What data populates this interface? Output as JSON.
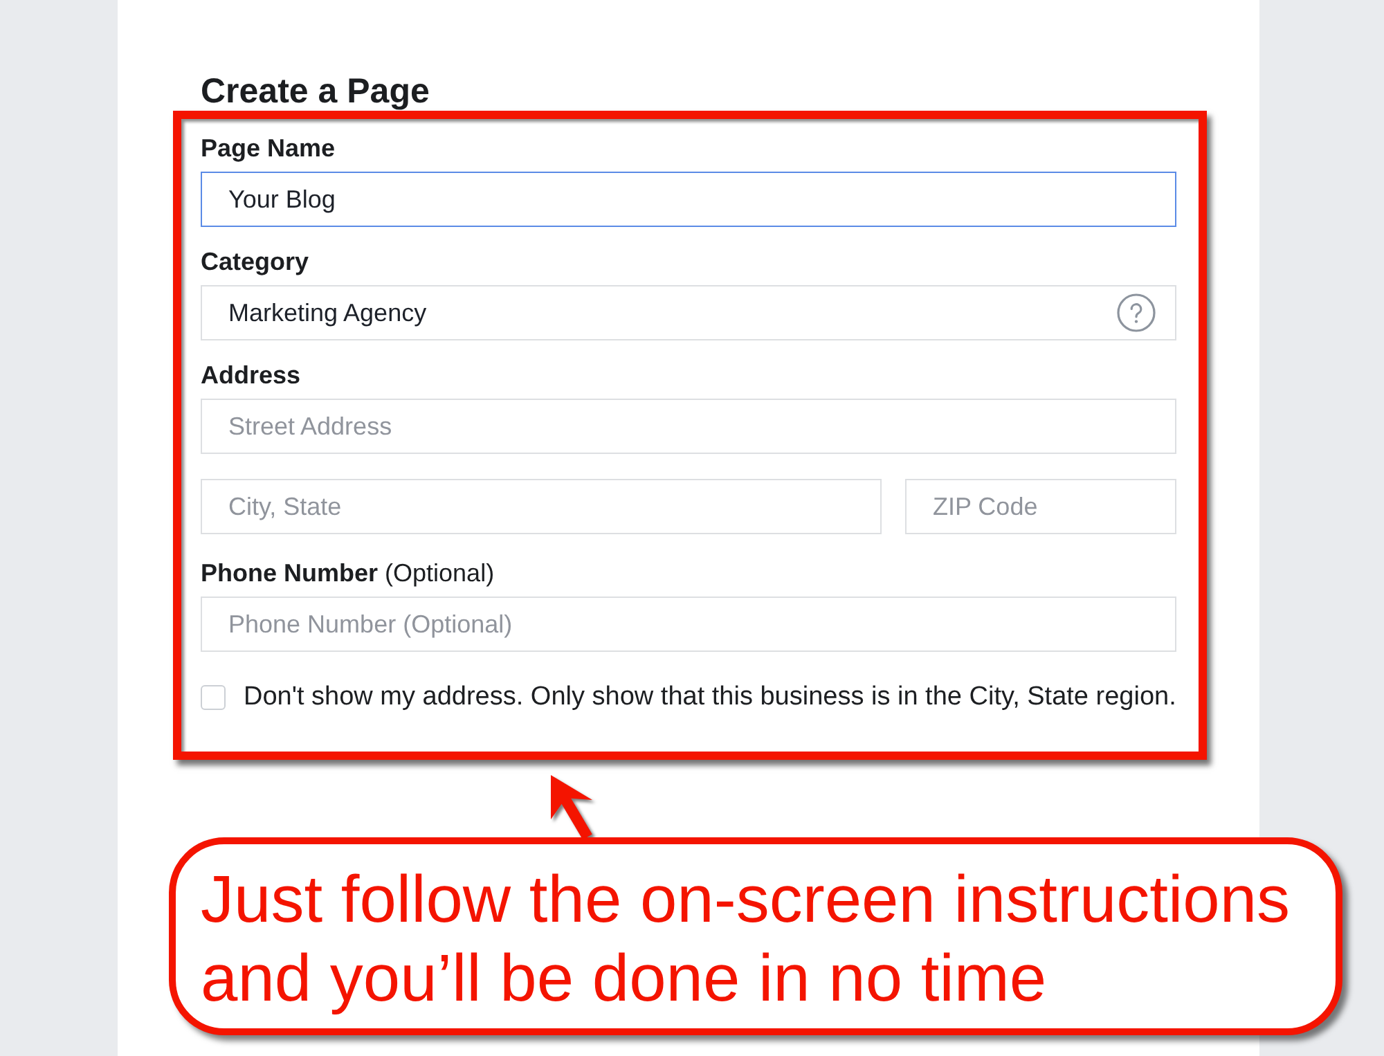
{
  "page": {
    "title": "Create a Page"
  },
  "form": {
    "fields": [
      {
        "kind": "input",
        "label": "Page Name",
        "value": "Your Blog",
        "focused": true
      },
      {
        "kind": "input_help",
        "label": "Category",
        "value": "Marketing Agency",
        "focused": false
      },
      {
        "kind": "address",
        "label": "Address",
        "street": {
          "placeholder": "Street Address",
          "focused": false
        },
        "city": {
          "placeholder": "City, State",
          "focused": false
        },
        "zip": {
          "placeholder": "ZIP Code",
          "focused": false
        }
      },
      {
        "kind": "input",
        "label": "Phone Number",
        "label_note": "(Optional)",
        "placeholder": "Phone Number (Optional)",
        "focused": false
      }
    ],
    "hide_address": {
      "label": "Don't show my address. Only show that this business is in the City, State region.",
      "checked": false
    }
  },
  "annotation": {
    "text": "Just follow the on-screen instructions and you’ll be done in no time"
  }
}
